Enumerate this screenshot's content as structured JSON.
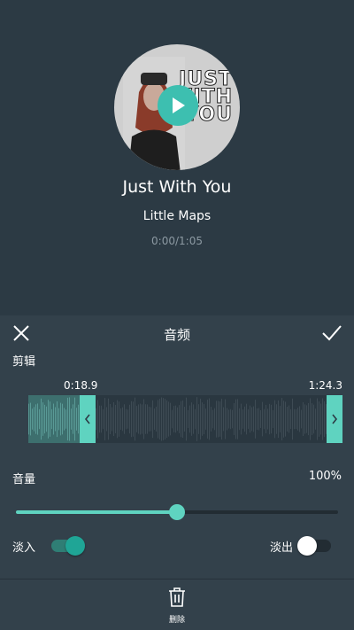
{
  "player": {
    "cover_text": "JUST WITH YOU",
    "song_title": "Just With You",
    "artist": "Little Maps",
    "time": "0:00/1:05"
  },
  "panel": {
    "title": "音频",
    "trim_label": "剪辑",
    "trim_start": "0:18.9",
    "trim_end": "1:24.3",
    "volume_label": "音量",
    "volume_value": "100%",
    "volume_level": 0.5,
    "fade_in_label": "淡入",
    "fade_in_on": true,
    "fade_out_label": "淡出",
    "fade_out_on": false,
    "delete_label": "删除"
  },
  "colors": {
    "accent": "#5fd3c0",
    "play": "#3dbfb0",
    "background": "#2c3a44",
    "panel": "#33414b"
  },
  "icons": [
    "play-icon",
    "close-icon",
    "check-icon",
    "chevron-left-icon",
    "chevron-right-icon",
    "trash-icon"
  ]
}
